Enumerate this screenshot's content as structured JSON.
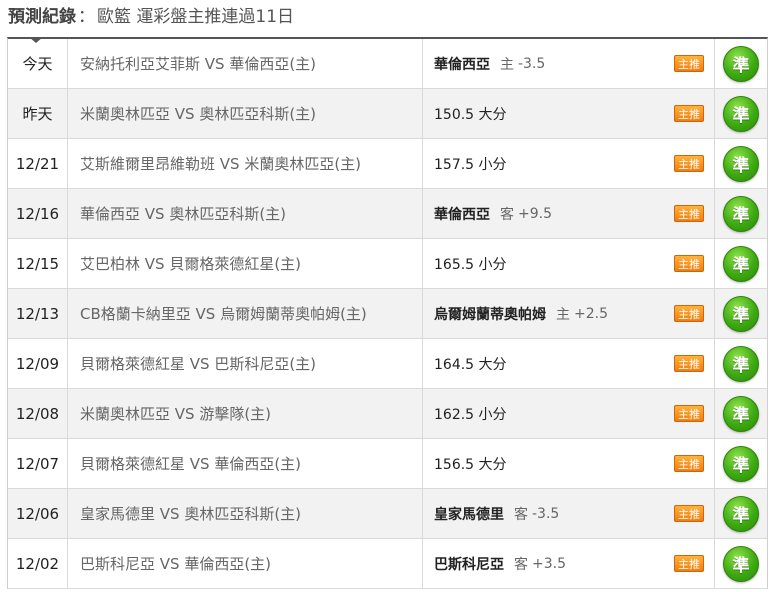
{
  "header": {
    "label": "預測紀錄",
    "separator": "：",
    "text": "歐籃 運彩盤主推連過11日"
  },
  "rows": [
    {
      "date": "今天",
      "match": "安納托利亞艾菲斯 VS 華倫西亞(主)",
      "pick_team": "華倫西亞",
      "pick_side": "主",
      "pick_line": "-3.5",
      "badge": "主推",
      "result": "準"
    },
    {
      "date": "昨天",
      "match": "米蘭奧林匹亞 VS 奧林匹亞科斯(主)",
      "pick_team": "",
      "pick_side": "",
      "pick_line": "150.5 大分",
      "badge": "主推",
      "result": "準"
    },
    {
      "date": "12/21",
      "match": "艾斯維爾里昂維勒班 VS 米蘭奧林匹亞(主)",
      "pick_team": "",
      "pick_side": "",
      "pick_line": "157.5 小分",
      "badge": "主推",
      "result": "準"
    },
    {
      "date": "12/16",
      "match": "華倫西亞 VS 奧林匹亞科斯(主)",
      "pick_team": "華倫西亞",
      "pick_side": "客",
      "pick_line": "+9.5",
      "badge": "主推",
      "result": "準"
    },
    {
      "date": "12/15",
      "match": "艾巴柏林 VS 貝爾格萊德紅星(主)",
      "pick_team": "",
      "pick_side": "",
      "pick_line": "165.5 小分",
      "badge": "主推",
      "result": "準"
    },
    {
      "date": "12/13",
      "match": "CB格蘭卡納里亞 VS 烏爾姆蘭蒂奧帕姆(主)",
      "pick_team": "烏爾姆蘭蒂奧帕姆",
      "pick_side": "主",
      "pick_line": "+2.5",
      "badge": "主推",
      "result": "準"
    },
    {
      "date": "12/09",
      "match": "貝爾格萊德紅星 VS 巴斯科尼亞(主)",
      "pick_team": "",
      "pick_side": "",
      "pick_line": "164.5 大分",
      "badge": "主推",
      "result": "準"
    },
    {
      "date": "12/08",
      "match": "米蘭奧林匹亞 VS 游擊隊(主)",
      "pick_team": "",
      "pick_side": "",
      "pick_line": "162.5 小分",
      "badge": "主推",
      "result": "準"
    },
    {
      "date": "12/07",
      "match": "貝爾格萊德紅星 VS 華倫西亞(主)",
      "pick_team": "",
      "pick_side": "",
      "pick_line": "156.5 大分",
      "badge": "主推",
      "result": "準"
    },
    {
      "date": "12/06",
      "match": "皇家馬德里 VS 奧林匹亞科斯(主)",
      "pick_team": "皇家馬德里",
      "pick_side": "客",
      "pick_line": "-3.5",
      "badge": "主推",
      "result": "準"
    },
    {
      "date": "12/02",
      "match": "巴斯科尼亞 VS 華倫西亞(主)",
      "pick_team": "巴斯科尼亞",
      "pick_side": "客",
      "pick_line": "+3.5",
      "badge": "主推",
      "result": "準"
    }
  ]
}
